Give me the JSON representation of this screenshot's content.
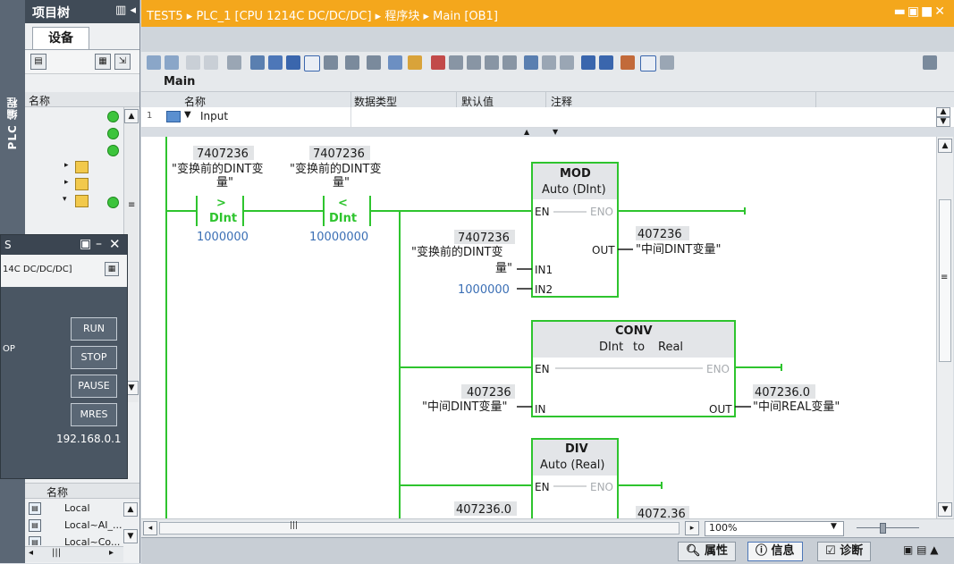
{
  "sidebar": {
    "vertical_label": "PLC 编程",
    "title": "项目树",
    "tab": "设备",
    "column_name": "名称",
    "detail_column": "名称",
    "detail_items": [
      "Local",
      "Local~AI_...",
      "Local~Co..."
    ]
  },
  "online_panel": {
    "title": "S",
    "device": "14C DC/DC/DC]",
    "mode_prefix": "OP",
    "buttons": [
      "RUN",
      "STOP",
      "PAUSE",
      "MRES"
    ],
    "ip": "192.168.0.1"
  },
  "editor": {
    "breadcrumb": [
      "TEST5",
      "PLC_1 [CPU 1214C DC/DC/DC]",
      "程序块",
      "Main [OB1]"
    ],
    "block_name": "Main",
    "interface_headers": [
      "名称",
      "数据类型",
      "默认值",
      "注释"
    ],
    "interface_row": {
      "num": "1",
      "name": "Input"
    },
    "zoom": "100%"
  },
  "ladder": {
    "contact1": {
      "actual": "7407236",
      "tag_line1": "\"变换前的DINT变",
      "tag_line2": "量\"",
      "op": ">",
      "type": "DInt",
      "compare": "1000000"
    },
    "contact2": {
      "actual": "7407236",
      "tag_line1": "\"变换前的DINT变",
      "tag_line2": "量\"",
      "op": "<",
      "type": "DInt",
      "compare": "10000000"
    },
    "mod": {
      "name": "MOD",
      "type": "Auto (DInt)",
      "en": "EN",
      "eno": "ENO",
      "in1": "IN1",
      "in2": "IN2",
      "out": "OUT",
      "in1_actual": "7407236",
      "in1_tag1": "\"变换前的DINT变",
      "in1_tag2": "量\"",
      "in2_val": "1000000",
      "out_actual": "407236",
      "out_tag": "\"中间DINT变量\""
    },
    "conv": {
      "name": "CONV",
      "from": "DInt",
      "to_word": "to",
      "to": "Real",
      "en": "EN",
      "eno": "ENO",
      "in": "IN",
      "out": "OUT",
      "in_actual": "407236",
      "in_tag": "\"中间DINT变量\"",
      "out_actual": "407236.0",
      "out_tag": "\"中间REAL变量\""
    },
    "div": {
      "name": "DIV",
      "type": "Auto (Real)",
      "en": "EN",
      "eno": "ENO",
      "in1_actual": "407236.0",
      "out_actual": "4072.36"
    }
  },
  "status_tabs": [
    "属性",
    "信息",
    "诊断"
  ],
  "colors": {
    "title_bar": "#f4a71c",
    "rung": "#2ec42e",
    "online_panel": "#4a5663"
  }
}
